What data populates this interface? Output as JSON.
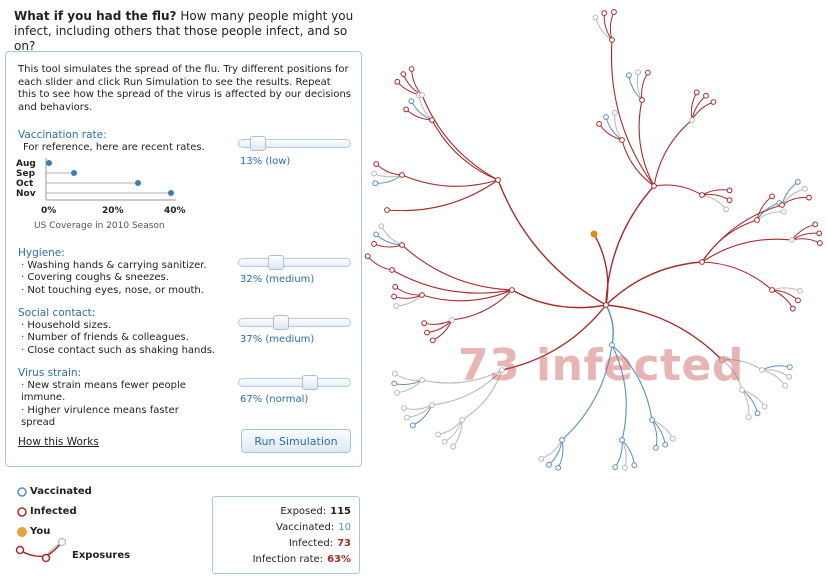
{
  "header": {
    "question_bold": "What if you had the flu?",
    "question_rest": "How many people might you infect, including others that those people infect, and so on?"
  },
  "intro": "This tool simulates the spread of the flu. Try different positions for each slider and click Run Simulation to see the results. Repeat this to see how the spread of the virus is affected by our decisions and behaviors.",
  "vaccination": {
    "title": "Vaccination rate:",
    "note": "For reference, here are recent rates.",
    "value_label": "13% (low)",
    "slider_value": 0.13,
    "chart": {
      "months": [
        "Aug",
        "Sep",
        "Oct",
        "Nov"
      ],
      "ticks": [
        "0%",
        "20%",
        "40%"
      ],
      "caption": "US Coverage in 2010 Season"
    }
  },
  "hygiene": {
    "title": "Hygiene:",
    "items": [
      "· Washing hands & carrying sanitizer.",
      "· Covering coughs & sneezes.",
      "· Not touching eyes, nose, or mouth."
    ],
    "value_label": "32% (medium)",
    "slider_value": 0.32
  },
  "social": {
    "title": "Social contact:",
    "items": [
      "· Household sizes.",
      "· Number of friends & colleagues.",
      "· Close contact such as shaking hands."
    ],
    "value_label": "37% (medium)",
    "slider_value": 0.37
  },
  "strain": {
    "title": "Virus strain:",
    "items": [
      "· New strain means fewer people immune.",
      "· Higher virulence means faster spread"
    ],
    "value_label": "67% (normal)",
    "slider_value": 0.67
  },
  "how_link": "How this Works",
  "run_button": "Run Simulation",
  "legend": {
    "vaccinated": "Vaccinated",
    "infected": "Infected",
    "you": "You",
    "exposures": "Exposures"
  },
  "stats": {
    "exposed_label": "Exposed:",
    "exposed_value": "115",
    "vaccinated_label": "Vaccinated:",
    "vaccinated_value": "10",
    "infected_label": "Infected:",
    "infected_value": "73",
    "rate_label": "Infection rate:",
    "rate_value": "63%"
  },
  "big_label": "73 infected",
  "colors": {
    "infected": "#a52a2a",
    "vaccinated": "#5b8fbf",
    "exposed": "#b8b8b8",
    "you": "#e08a1e",
    "accent": "#2a6fab"
  }
}
